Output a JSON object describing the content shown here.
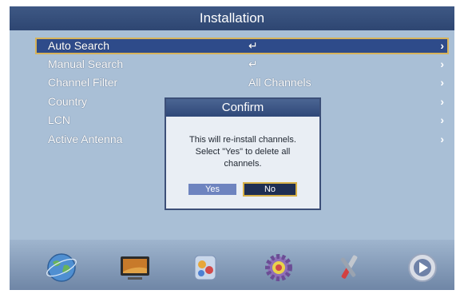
{
  "title": "Installation",
  "menu": [
    {
      "label": "Auto Search",
      "value": "↵",
      "arrow": "›"
    },
    {
      "label": "Manual Search",
      "value": "↵",
      "arrow": "›"
    },
    {
      "label": "Channel Filter",
      "value": "All Channels",
      "arrow": "›"
    },
    {
      "label": "Country",
      "value": "",
      "arrow": "›"
    },
    {
      "label": "LCN",
      "value": "",
      "arrow": "›"
    },
    {
      "label": "Active Antenna",
      "value": "",
      "arrow": "›"
    }
  ],
  "dialog": {
    "title": "Confirm",
    "line1": "This will re-install channels.",
    "line2": "Select \"Yes\" to delete all",
    "line3": "channels.",
    "yes": "Yes",
    "no": "No"
  },
  "dock": [
    "globe-icon",
    "tv-screen-icon",
    "media-icon",
    "settings-icon",
    "tools-icon",
    "play-icon"
  ],
  "colors": {
    "title_bar": "#2e4672",
    "background": "#a9bfd6",
    "selected_row": "#2e4b8a",
    "highlight_border": "#d6b048"
  }
}
